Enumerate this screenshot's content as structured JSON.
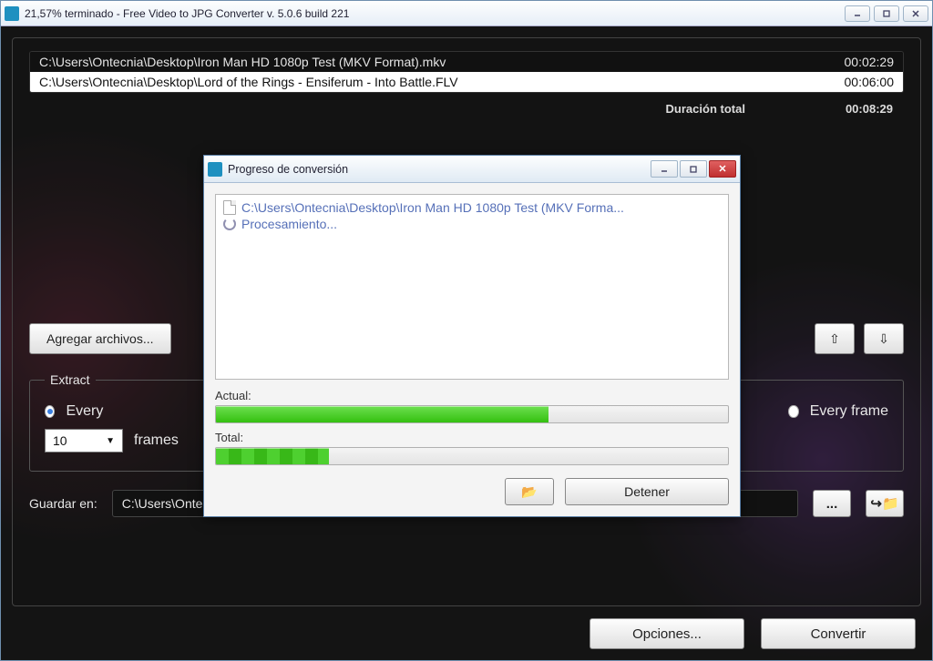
{
  "window": {
    "title": "21,57% terminado - Free Video to JPG Converter  v. 5.0.6 build 221"
  },
  "filelist": {
    "items": [
      {
        "path": "C:\\Users\\Ontecnia\\Desktop\\Iron Man HD 1080p Test (MKV Format).mkv",
        "duration": "00:02:29",
        "selected": false
      },
      {
        "path": "C:\\Users\\Ontecnia\\Desktop\\Lord of the Rings - Ensiferum - Into Battle.FLV",
        "duration": "00:06:00",
        "selected": true
      }
    ],
    "total_label": "Duración total",
    "total_value": "00:08:29"
  },
  "buttons": {
    "add_files": "Agregar archivos...",
    "options": "Opciones...",
    "convert": "Convertir"
  },
  "extract": {
    "legend": "Extract",
    "every_label": "Every",
    "frames_label": "frames",
    "every_value": "10",
    "every_frame_label": "Every frame",
    "mode": "every_n"
  },
  "save": {
    "label": "Guardar en:",
    "path": "C:\\Users\\Ontecnia\\Pictures\\FreeVideoToJPGConverter\\"
  },
  "dialog": {
    "title": "Progreso de conversión",
    "file": "C:\\Users\\Ontecnia\\Desktop\\Iron Man HD 1080p Test (MKV Forma...",
    "status": "Procesamiento...",
    "actual_label": "Actual:",
    "total_label": "Total:",
    "actual_pct": 65,
    "total_pct": 22,
    "stop": "Detener"
  }
}
